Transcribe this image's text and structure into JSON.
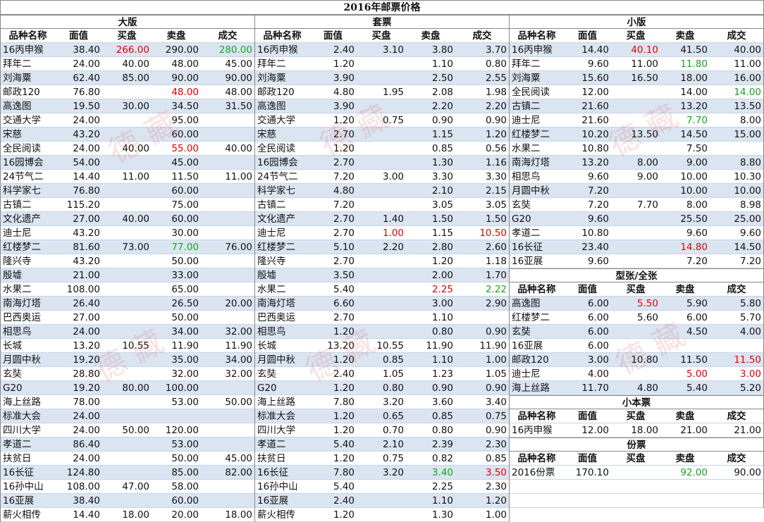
{
  "title": "2016年邮票价格",
  "headers": [
    "品种名称",
    "面值",
    "买盘",
    "卖盘",
    "成交"
  ],
  "watermark": "德  藏",
  "colors": {
    "up": "#e00000",
    "down": "#17a61f",
    "band": "#dbe5f1"
  },
  "big": {
    "title": "大版",
    "rows": [
      [
        "16丙申猴",
        "38.40",
        "266.00",
        "290.00",
        "280.00"
      ],
      [
        "拜年二",
        "24.00",
        "40.00",
        "48.00",
        "45.00"
      ],
      [
        "刘海粟",
        "62.40",
        "85.00",
        "90.00",
        "90.00"
      ],
      [
        "邮政120",
        "76.80",
        "",
        "48.00",
        "48.00"
      ],
      [
        "高逸图",
        "19.50",
        "30.00",
        "34.50",
        "31.50"
      ],
      [
        "交通大学",
        "24.00",
        "",
        "95.00",
        ""
      ],
      [
        "宋慈",
        "43.20",
        "",
        "60.00",
        ""
      ],
      [
        "全民阅读",
        "24.00",
        "40.00",
        "55.00",
        "40.00"
      ],
      [
        "16园博会",
        "54.00",
        "",
        "45.00",
        ""
      ],
      [
        "24节气二",
        "14.40",
        "11.00",
        "11.50",
        "11.00"
      ],
      [
        "科学家七",
        "76.80",
        "",
        "60.00",
        ""
      ],
      [
        "古镇二",
        "115.20",
        "",
        "75.00",
        ""
      ],
      [
        "文化遗产",
        "27.00",
        "40.00",
        "60.00",
        ""
      ],
      [
        "迪士尼",
        "43.20",
        "",
        "30.00",
        ""
      ],
      [
        "红楼梦二",
        "81.60",
        "73.00",
        "77.00",
        "76.00"
      ],
      [
        "隆兴寺",
        "43.20",
        "",
        "50.00",
        ""
      ],
      [
        "殷墟",
        "21.00",
        "",
        "33.00",
        ""
      ],
      [
        "水果二",
        "108.00",
        "",
        "65.00",
        ""
      ],
      [
        "南海灯塔",
        "26.40",
        "",
        "26.50",
        "20.00"
      ],
      [
        "巴西奥运",
        "27.00",
        "",
        "50.00",
        ""
      ],
      [
        "相思鸟",
        "24.00",
        "",
        "34.00",
        "32.00"
      ],
      [
        "长城",
        "13.20",
        "10.55",
        "11.90",
        "11.90"
      ],
      [
        "月圆中秋",
        "19.20",
        "",
        "35.00",
        "34.00"
      ],
      [
        "玄奘",
        "28.80",
        "",
        "32.00",
        "32.00"
      ],
      [
        "G20",
        "19.20",
        "80.00",
        "100.00",
        ""
      ],
      [
        "海上丝路",
        "78.00",
        "",
        "53.00",
        "50.00"
      ],
      [
        "标准大会",
        "24.00",
        "",
        "",
        ""
      ],
      [
        "四川大学",
        "24.00",
        "50.00",
        "120.00",
        ""
      ],
      [
        "孝道二",
        "86.40",
        "",
        "53.00",
        ""
      ],
      [
        "扶贫日",
        "24.00",
        "",
        "50.00",
        "45.00"
      ],
      [
        "16长征",
        "124.80",
        "",
        "85.00",
        "82.00"
      ],
      [
        "16孙中山",
        "108.00",
        "47.00",
        "58.00",
        ""
      ],
      [
        "16亚展",
        "38.40",
        "",
        "60.00",
        ""
      ],
      [
        "薪火相传",
        "14.40",
        "18.00",
        "20.00",
        "18.00"
      ]
    ]
  },
  "set": {
    "title": "套票",
    "rows": [
      [
        "16丙申猴",
        "2.40",
        "3.10",
        "3.80",
        "3.70"
      ],
      [
        "拜年二",
        "1.20",
        "",
        "1.10",
        "0.80"
      ],
      [
        "刘海粟",
        "3.90",
        "",
        "2.50",
        "2.55"
      ],
      [
        "邮政120",
        "4.80",
        "1.95",
        "2.08",
        "1.98"
      ],
      [
        "高逸图",
        "3.90",
        "",
        "2.20",
        "2.20"
      ],
      [
        "交通大学",
        "1.20",
        "0.75",
        "0.90",
        "0.90"
      ],
      [
        "宋慈",
        "2.70",
        "",
        "1.15",
        "1.20"
      ],
      [
        "全民阅读",
        "1.20",
        "",
        "0.85",
        "0.56"
      ],
      [
        "16园博会",
        "2.70",
        "",
        "1.30",
        "1.16"
      ],
      [
        "24节气二",
        "7.20",
        "3.00",
        "3.30",
        "3.30"
      ],
      [
        "科学家七",
        "4.80",
        "",
        "2.10",
        "2.15"
      ],
      [
        "古镇二",
        "7.20",
        "",
        "3.05",
        "3.05"
      ],
      [
        "文化遗产",
        "2.70",
        "1.40",
        "1.50",
        "1.50"
      ],
      [
        "迪士尼",
        "2.70",
        "1.00",
        "1.15",
        "10.50"
      ],
      [
        "红楼梦二",
        "5.10",
        "2.20",
        "2.80",
        "2.60"
      ],
      [
        "隆兴寺",
        "2.70",
        "",
        "1.20",
        "1.18"
      ],
      [
        "殷墟",
        "3.50",
        "",
        "2.00",
        "1.70"
      ],
      [
        "水果二",
        "5.40",
        "",
        "2.25",
        "2.22"
      ],
      [
        "南海灯塔",
        "6.60",
        "",
        "3.00",
        "2.90"
      ],
      [
        "巴西奥运",
        "2.70",
        "",
        "1.10",
        ""
      ],
      [
        "相思鸟",
        "1.20",
        "",
        "0.80",
        "0.90"
      ],
      [
        "长城",
        "13.20",
        "10.55",
        "11.90",
        "11.90"
      ],
      [
        "月圆中秋",
        "1.20",
        "0.85",
        "1.10",
        "1.00"
      ],
      [
        "玄奘",
        "2.40",
        "1.05",
        "1.23",
        "1.05"
      ],
      [
        "G20",
        "1.20",
        "0.80",
        "0.90",
        "0.90"
      ],
      [
        "海上丝路",
        "7.80",
        "3.20",
        "3.60",
        "3.40"
      ],
      [
        "标准大会",
        "1.20",
        "0.65",
        "0.85",
        "0.75"
      ],
      [
        "四川大学",
        "1.20",
        "0.70",
        "0.80",
        "0.90"
      ],
      [
        "孝道二",
        "5.40",
        "2.10",
        "2.39",
        "2.30"
      ],
      [
        "扶贫日",
        "1.20",
        "0.75",
        "0.82",
        "0.85"
      ],
      [
        "16长征",
        "7.80",
        "3.20",
        "3.40",
        "3.50"
      ],
      [
        "16孙中山",
        "5.40",
        "",
        "2.25",
        "2.30"
      ],
      [
        "16亚展",
        "2.40",
        "",
        "1.10",
        "1.20"
      ],
      [
        "薪火相传",
        "1.20",
        "",
        "1.30",
        "1.00"
      ]
    ]
  },
  "small": {
    "title": "小版",
    "rows": [
      [
        "16丙申猴",
        "14.40",
        "40.10",
        "41.50",
        "40.00"
      ],
      [
        "拜年二",
        "9.60",
        "11.00",
        "11.80",
        "11.00"
      ],
      [
        "刘海粟",
        "15.60",
        "16.50",
        "18.00",
        "16.00"
      ],
      [
        "全民阅读",
        "12.00",
        "",
        "14.00",
        "14.00"
      ],
      [
        "古镇二",
        "21.60",
        "",
        "13.20",
        "13.50"
      ],
      [
        "迪士尼",
        "21.60",
        "",
        "7.70",
        "8.00"
      ],
      [
        "红楼梦二",
        "10.20",
        "13.50",
        "14.50",
        "15.00"
      ],
      [
        "水果二",
        "10.80",
        "",
        "7.50",
        ""
      ],
      [
        "南海灯塔",
        "13.20",
        "8.00",
        "9.00",
        "8.80"
      ],
      [
        "相思鸟",
        "9.60",
        "9.00",
        "10.00",
        "10.30"
      ],
      [
        "月圆中秋",
        "7.20",
        "",
        "10.00",
        "10.00"
      ],
      [
        "玄奘",
        "7.20",
        "7.70",
        "8.00",
        "8.98"
      ],
      [
        "G20",
        "9.60",
        "",
        "25.50",
        "25.00"
      ],
      [
        "孝道二",
        "10.80",
        "",
        "9.60",
        "9.60"
      ],
      [
        "16长征",
        "23.40",
        "",
        "14.80",
        "14.50"
      ],
      [
        "16亚展",
        "9.60",
        "",
        "7.20",
        "7.20"
      ]
    ]
  },
  "sheet": {
    "title": "型张/全张",
    "rows": [
      [
        "高逸图",
        "6.00",
        "5.50",
        "5.90",
        "5.80"
      ],
      [
        "红楼梦二",
        "6.00",
        "5.60",
        "6.00",
        "5.70"
      ],
      [
        "玄奘",
        "6.00",
        "",
        "4.50",
        "4.00"
      ],
      [
        "16亚展",
        "6.00",
        "",
        "",
        ""
      ],
      [
        "邮政120",
        "3.00",
        "10.80",
        "11.50",
        "11.50"
      ],
      [
        "迪士尼",
        "4.00",
        "",
        "5.00",
        "3.00"
      ],
      [
        "海上丝路",
        "11.70",
        "4.80",
        "5.40",
        "5.20"
      ]
    ]
  },
  "booklet": {
    "title": "小本票",
    "rows": [
      [
        "16丙申猴",
        "12.00",
        "18.00",
        "21.00",
        "21.00"
      ]
    ]
  },
  "yearset": {
    "title": "份票",
    "rows": [
      [
        "2016份票",
        "170.10",
        "",
        "92.00",
        "90.00"
      ]
    ]
  }
}
